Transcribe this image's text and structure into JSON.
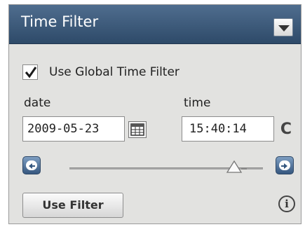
{
  "panel": {
    "title": "Time Filter"
  },
  "global_filter": {
    "label": "Use Global Time Filter",
    "checked": true
  },
  "date": {
    "label": "date",
    "value": "2009-05-23"
  },
  "time": {
    "label": "time",
    "value": "15:40:14"
  },
  "slider": {
    "position_fraction": 0.85
  },
  "actions": {
    "use_filter_label": "Use Filter",
    "info_glyph": "i",
    "refresh_glyph": "C"
  },
  "icons": {
    "collapse": "chevron-down-icon",
    "calendar": "calendar-icon",
    "refresh": "refresh-icon",
    "prev": "step-back-icon",
    "next": "step-forward-icon",
    "info": "info-icon"
  },
  "colors": {
    "header": "#3d5a7c",
    "panel_bg": "#e2e2e0"
  }
}
